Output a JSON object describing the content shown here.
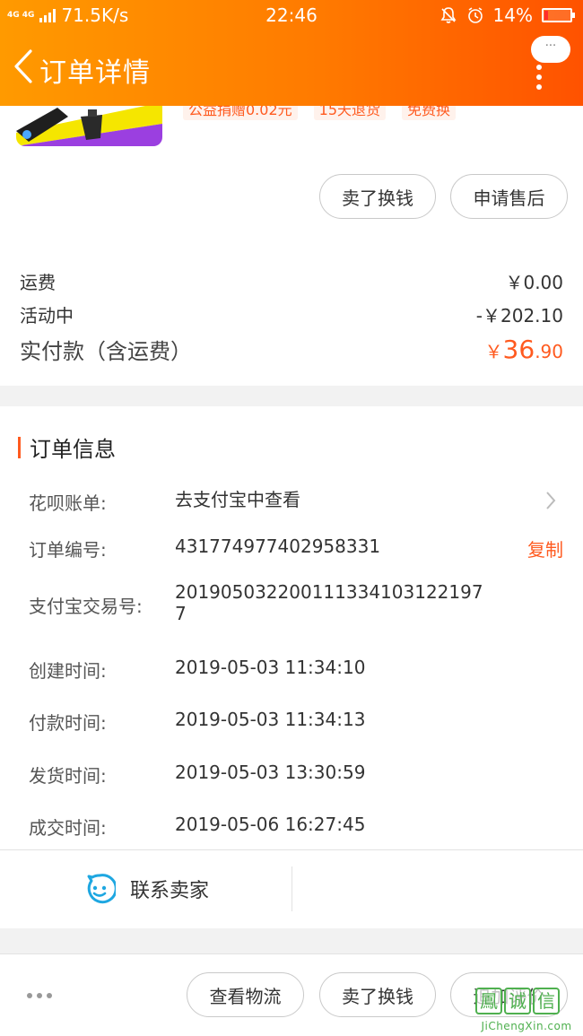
{
  "status_bar": {
    "network_badge": "4G 4G",
    "speed": "71.5K/s",
    "time": "22:46",
    "battery": "14%",
    "battery_level": 0.14
  },
  "header": {
    "title": "订单详情",
    "more_bubble": "···"
  },
  "product": {
    "tags": [
      "公益捐赠0.02元",
      "15天退货",
      "免费换"
    ],
    "actions": [
      "卖了换钱",
      "申请售后"
    ]
  },
  "fees": {
    "shipping_label": "运费",
    "shipping_value": "￥0.00",
    "promo_label": "活动中",
    "promo_value": "-￥202.10",
    "paid_label": "实付款（含运费）",
    "paid_currency": "￥",
    "paid_int": "36",
    "paid_dec": ".90"
  },
  "order_info": {
    "title": "订单信息",
    "huabei_label": "花呗账单:",
    "huabei_value": "去支付宝中查看",
    "order_no_label": "订单编号:",
    "order_no_value": "431774977402958331",
    "copy_label": "复制",
    "alipay_label": "支付宝交易号:",
    "alipay_value": "2019050322001113341031221977",
    "created_label": "创建时间:",
    "created_value": "2019-05-03 11:34:10",
    "paid_label": "付款时间:",
    "paid_value": "2019-05-03 11:34:13",
    "shipped_label": "发货时间:",
    "shipped_value": "2019-05-03 13:30:59",
    "closed_label": "成交时间:",
    "closed_value": "2019-05-06 16:27:45",
    "contact_label": "联系卖家"
  },
  "bottom_bar": {
    "actions": [
      "查看物流",
      "卖了换钱",
      "追加评价"
    ]
  },
  "watermark": {
    "chars": [
      "鳳",
      "诚",
      "信"
    ],
    "url": "JiChengXin.com"
  },
  "colors": {
    "accent": "#ff5a1f",
    "header_start": "#ff9a00",
    "header_end": "#ff5200",
    "contact_icon": "#1ea7e1"
  }
}
